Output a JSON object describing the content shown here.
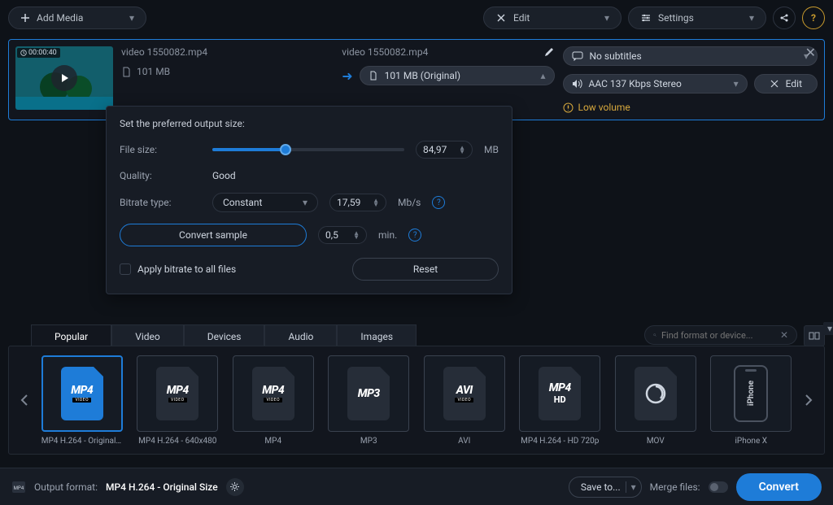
{
  "toolbar": {
    "add_media": "Add Media",
    "edit": "Edit",
    "settings": "Settings"
  },
  "file": {
    "duration": "00:00:40",
    "name_in": "video 1550082.mp4",
    "name_out": "video 1550082.mp4",
    "size_in": "101 MB",
    "size_out": "101 MB (Original)",
    "subtitles": "No subtitles",
    "audio": "AAC 137 Kbps Stereo",
    "edit": "Edit",
    "warning": "Low volume"
  },
  "panel": {
    "title": "Set the preferred output size:",
    "file_size_label": "File size:",
    "file_size_value": "84,97",
    "file_size_unit": "MB",
    "quality_label": "Quality:",
    "quality_value": "Good",
    "bitrate_type_label": "Bitrate type:",
    "bitrate_type_value": "Constant",
    "bitrate_value": "17,59",
    "bitrate_unit": "Mb/s",
    "convert_sample": "Convert sample",
    "sample_duration": "0,5",
    "sample_unit": "min.",
    "apply_all": "Apply bitrate to all files",
    "reset": "Reset",
    "slider_pct": 38
  },
  "tabs": [
    "Popular",
    "Video",
    "Devices",
    "Audio",
    "Images"
  ],
  "active_tab": 0,
  "search_placeholder": "Find format or device...",
  "formats": [
    {
      "label": "MP4 H.264 - Original ...",
      "big": "MP4",
      "sub": "VIDEO",
      "color": "bl",
      "selected": true
    },
    {
      "label": "MP4 H.264 - 640x480",
      "big": "MP4",
      "sub": "VIDEO",
      "color": "dk"
    },
    {
      "label": "MP4",
      "big": "MP4",
      "sub": "VIDEO",
      "color": "dk"
    },
    {
      "label": "MP3",
      "big": "MP3",
      "sub": "",
      "color": "dk"
    },
    {
      "label": "AVI",
      "big": "AVI",
      "sub": "VIDEO",
      "color": "dk"
    },
    {
      "label": "MP4 H.264 - HD 720p",
      "big": "MP4",
      "sub": "HD",
      "color": "dk",
      "hd": true
    },
    {
      "label": "MOV",
      "big": "",
      "sub": "",
      "color": "dk",
      "mov": true
    },
    {
      "label": "iPhone X",
      "big": "",
      "sub": "",
      "phone": true
    }
  ],
  "footer": {
    "output_label": "Output format:",
    "output_value": "MP4 H.264 - Original Size",
    "save_to": "Save to...",
    "merge": "Merge files:",
    "convert": "Convert"
  }
}
